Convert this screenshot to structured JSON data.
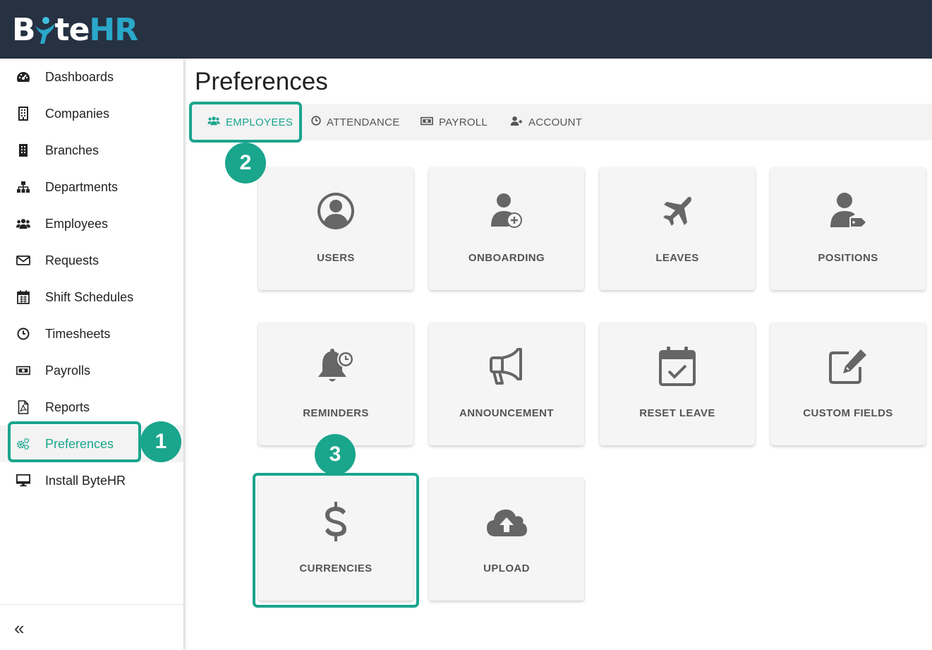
{
  "brand": {
    "logo_text_left": "B",
    "logo_text_mid": "te",
    "logo_text_right": "HR",
    "accent": "#1aa58d",
    "topbar_color": "#263142"
  },
  "sidebar": {
    "items": [
      {
        "label": "Dashboards",
        "icon": "tachometer-icon"
      },
      {
        "label": "Companies",
        "icon": "building-outline-icon"
      },
      {
        "label": "Branches",
        "icon": "building-icon"
      },
      {
        "label": "Departments",
        "icon": "sitemap-icon"
      },
      {
        "label": "Employees",
        "icon": "users-icon"
      },
      {
        "label": "Requests",
        "icon": "envelope-icon"
      },
      {
        "label": "Shift Schedules",
        "icon": "calendar-icon"
      },
      {
        "label": "Timesheets",
        "icon": "clock-icon"
      },
      {
        "label": "Payrolls",
        "icon": "money-bill-icon"
      },
      {
        "label": "Reports",
        "icon": "file-pdf-icon"
      },
      {
        "label": "Preferences",
        "icon": "cogs-icon",
        "active": true
      },
      {
        "label": "Install ByteHR",
        "icon": "desktop-icon"
      }
    ],
    "collapse_label": "«"
  },
  "main": {
    "title": "Preferences",
    "tabs": [
      {
        "label": "EMPLOYEES",
        "icon": "users-icon",
        "active": true
      },
      {
        "label": "ATTENDANCE",
        "icon": "clock-icon"
      },
      {
        "label": "PAYROLL",
        "icon": "money-bill-icon"
      },
      {
        "label": "ACCOUNT",
        "icon": "user-plus-icon"
      }
    ],
    "cards": [
      {
        "label": "USERS",
        "icon": "user-circle-icon"
      },
      {
        "label": "ONBOARDING",
        "icon": "user-plus-icon"
      },
      {
        "label": "LEAVES",
        "icon": "plane-icon"
      },
      {
        "label": "POSITIONS",
        "icon": "user-tag-icon"
      },
      {
        "label": "REMINDERS",
        "icon": "bell-clock-icon"
      },
      {
        "label": "ANNOUNCEMENT",
        "icon": "bullhorn-icon"
      },
      {
        "label": "RESET LEAVE",
        "icon": "calendar-check-icon"
      },
      {
        "label": "CUSTOM FIELDS",
        "icon": "edit-icon"
      },
      {
        "label": "CURRENCIES",
        "icon": "dollar-icon"
      },
      {
        "label": "UPLOAD",
        "icon": "cloud-upload-icon"
      }
    ]
  },
  "callouts": {
    "step1": "1",
    "step2": "2",
    "step3": "3"
  }
}
